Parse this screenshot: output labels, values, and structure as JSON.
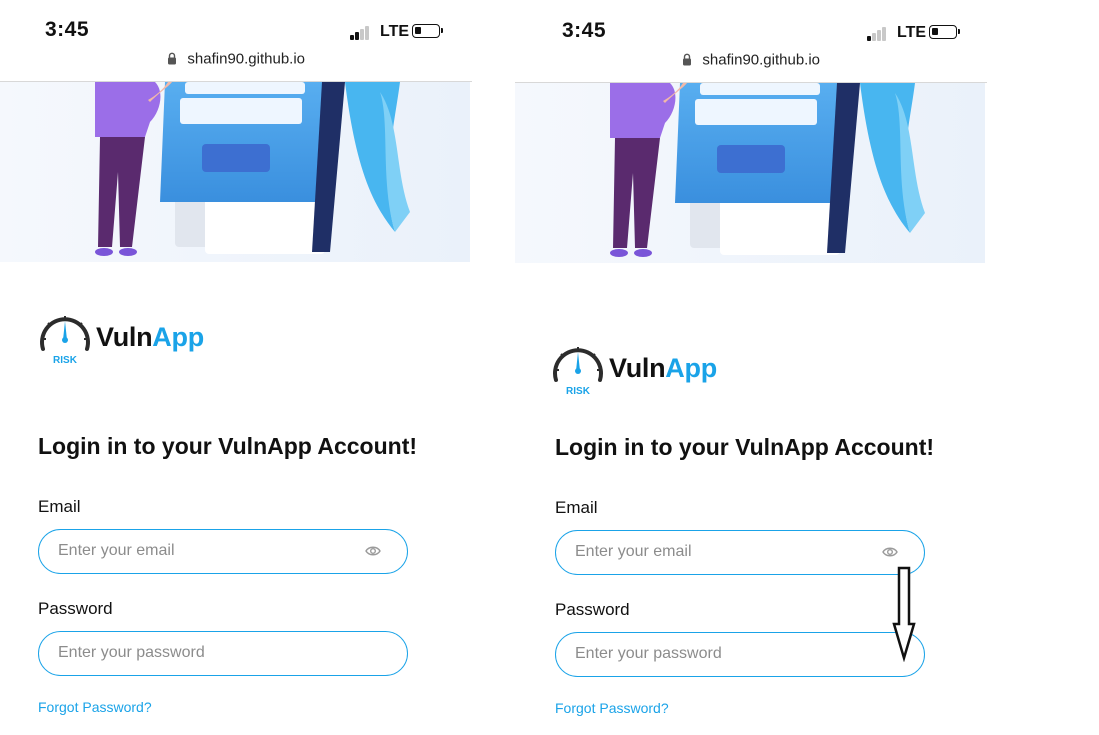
{
  "screens": [
    {
      "status": {
        "time": "3:45",
        "network": "LTE"
      },
      "url": "shafin90.github.io",
      "logo": {
        "word_a": "Vuln",
        "word_b": "App",
        "badge": "RISK"
      },
      "heading": "Login in to your VulnApp Account!",
      "email": {
        "label": "Email",
        "placeholder": "Enter your email"
      },
      "password": {
        "label": "Password",
        "placeholder": "Enter your password"
      },
      "forgot": "Forgot Password?"
    },
    {
      "status": {
        "time": "3:45",
        "network": "LTE"
      },
      "url": "shafin90.github.io",
      "logo": {
        "word_a": "Vuln",
        "word_b": "App",
        "badge": "RISK"
      },
      "heading": "Login in to your VulnApp Account!",
      "email": {
        "label": "Email",
        "placeholder": "Enter your email"
      },
      "password": {
        "label": "Password",
        "placeholder": "Enter your password"
      },
      "forgot": "Forgot Password?"
    }
  ],
  "icons": {
    "lock": "lock-icon",
    "eye": "eye-icon",
    "signal": "signal-icon",
    "battery": "battery-icon",
    "gauge": "gauge-icon",
    "arrow": "down-arrow-annotation"
  },
  "colors": {
    "brand_blue": "#1aa3e8",
    "text": "#111111",
    "placeholder": "#8c8c8c",
    "illustration_purple": "#9b6ee8"
  }
}
